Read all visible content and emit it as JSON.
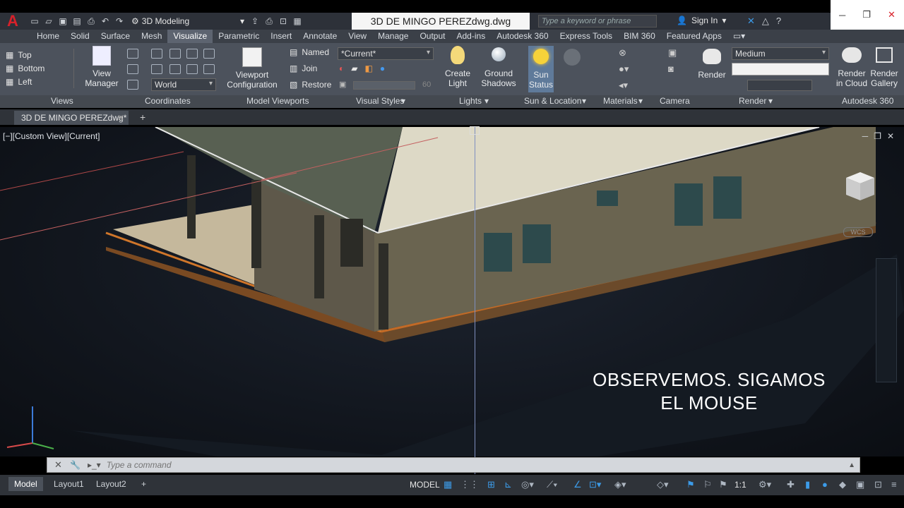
{
  "title_bar": {
    "workspace": "3D Modeling",
    "document_title": "3D DE MINGO PEREZdwg.dwg",
    "search_placeholder": "Type a keyword or phrase",
    "sign_in": "Sign In"
  },
  "ribbon_tabs": [
    "Home",
    "Solid",
    "Surface",
    "Mesh",
    "Visualize",
    "Parametric",
    "Insert",
    "Annotate",
    "View",
    "Manage",
    "Output",
    "Add-ins",
    "Autodesk 360",
    "Express Tools",
    "BIM 360",
    "Featured Apps"
  ],
  "active_tab": "Visualize",
  "ribbon": {
    "views": {
      "items": [
        "Top",
        "Bottom",
        "Left"
      ],
      "view_manager": "View Manager",
      "label": "Views"
    },
    "coordinates": {
      "ucs": "World",
      "label": "Coordinates"
    },
    "model_viewports": {
      "viewport_config": "Viewport Configuration",
      "named": "Named",
      "join": "Join",
      "restore": "Restore",
      "label": "Model Viewports"
    },
    "visual_styles": {
      "current": "*Current*",
      "x_ray_value": "60",
      "label": "Visual Styles"
    },
    "lights": {
      "create_light": "Create Light",
      "ground_shadows": "Ground Shadows",
      "label": "Lights"
    },
    "sun": {
      "sun_status": "Sun Status",
      "label": "Sun & Location"
    },
    "materials": {
      "label": "Materials"
    },
    "camera": {
      "label": "Camera"
    },
    "render": {
      "render": "Render",
      "preset": "Medium",
      "label": "Render"
    },
    "autodesk360": {
      "render_cloud": "Render in Cloud",
      "render_gallery": "Render Gallery",
      "label": "Autodesk 360"
    }
  },
  "file_tab": "3D DE MINGO PEREZdwg*",
  "viewport": {
    "label": "[−][Custom View][Current]",
    "caption_line1": "OBSERVEMOS. SIGAMOS",
    "caption_line2": "EL MOUSE",
    "wcs": "WCS"
  },
  "command_line": {
    "placeholder": "Type a command"
  },
  "status_bar": {
    "layouts": [
      "Model",
      "Layout1",
      "Layout2"
    ],
    "model_space": "MODEL",
    "scale": "1:1"
  },
  "colors": {
    "accent_blue": "#3c9be8",
    "autocad_red": "#d8212a",
    "ribbon_bg": "#4c525c"
  }
}
